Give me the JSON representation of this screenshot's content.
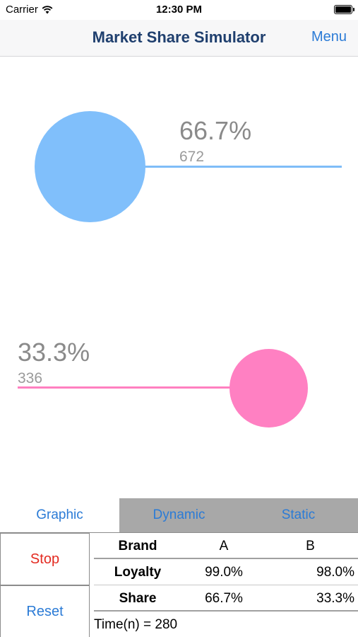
{
  "status_bar": {
    "carrier": "Carrier",
    "time": "12:30 PM"
  },
  "nav": {
    "title": "Market Share Simulator",
    "menu_label": "Menu"
  },
  "graphic": {
    "brand_a": {
      "percent": "66.7%",
      "count": "672",
      "color": "#80bffb"
    },
    "brand_b": {
      "percent": "33.3%",
      "count": "336",
      "color": "#ff80c2"
    }
  },
  "tabs": [
    {
      "label": "Graphic",
      "selected": true
    },
    {
      "label": "Dynamic",
      "selected": false
    },
    {
      "label": "Static",
      "selected": false
    }
  ],
  "controls": {
    "stop_label": "Stop",
    "reset_label": "Reset"
  },
  "table": {
    "header": [
      "Brand",
      "A",
      "B"
    ],
    "rows": [
      [
        "Loyalty",
        "99.0%",
        "98.0%"
      ],
      [
        "Share",
        "66.7%",
        "33.3%"
      ]
    ]
  },
  "time_text": "Time(n) = 280",
  "colors": {
    "accent": "#2b7bd6",
    "stop": "#e32a20",
    "title": "#1f3f6e"
  }
}
